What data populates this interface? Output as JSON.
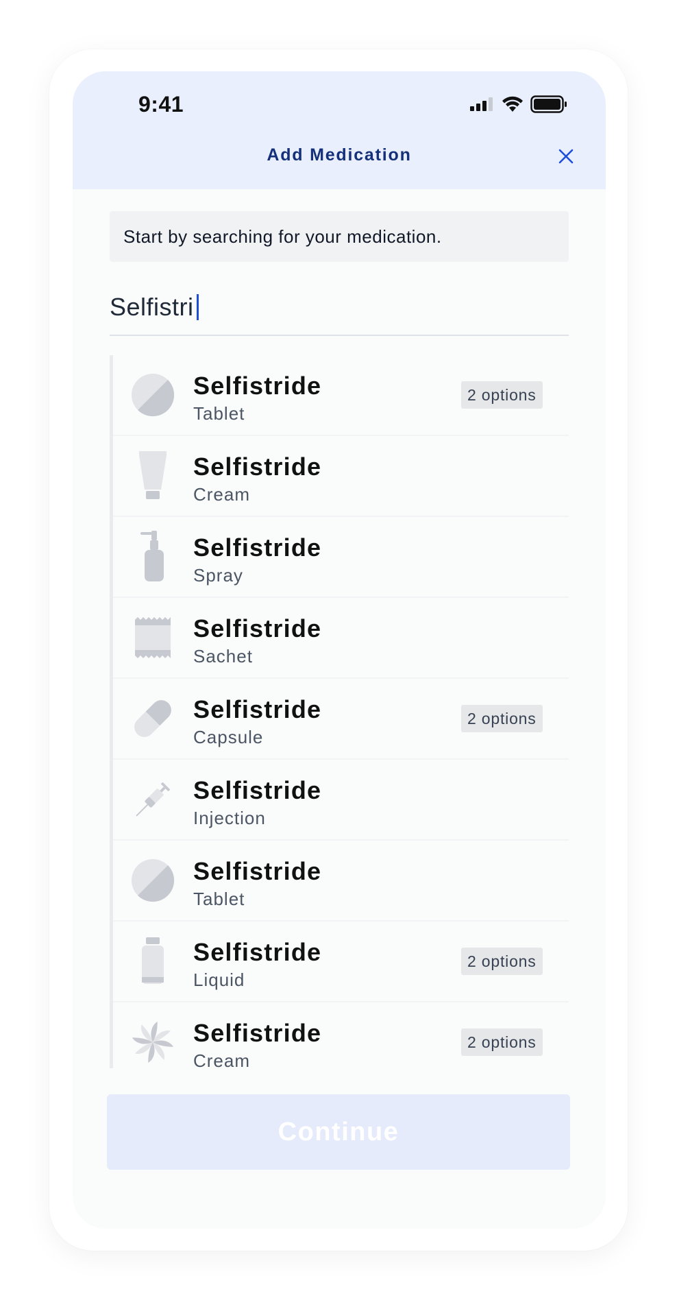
{
  "status_bar": {
    "time": "9:41"
  },
  "header": {
    "title": "Add Medication"
  },
  "hint": "Start by searching for your medication.",
  "search": {
    "value": "Selfistri"
  },
  "results": [
    {
      "name": "Selfistride",
      "form": "Tablet",
      "icon": "tablet-icon",
      "badge": "2 options"
    },
    {
      "name": "Selfistride",
      "form": "Cream",
      "icon": "cream-tube-icon",
      "badge": ""
    },
    {
      "name": "Selfistride",
      "form": "Spray",
      "icon": "spray-bottle-icon",
      "badge": ""
    },
    {
      "name": "Selfistride",
      "form": "Sachet",
      "icon": "sachet-icon",
      "badge": ""
    },
    {
      "name": "Selfistride",
      "form": "Capsule",
      "icon": "capsule-icon",
      "badge": "2 options"
    },
    {
      "name": "Selfistride",
      "form": "Injection",
      "icon": "syringe-icon",
      "badge": ""
    },
    {
      "name": "Selfistride",
      "form": "Tablet",
      "icon": "tablet-icon",
      "badge": ""
    },
    {
      "name": "Selfistride",
      "form": "Liquid",
      "icon": "liquid-bottle-icon",
      "badge": "2 options"
    },
    {
      "name": "Selfistride",
      "form": "Cream",
      "icon": "pinwheel-icon",
      "badge": "2 options"
    }
  ],
  "continue_label": "Continue",
  "colors": {
    "header_bg": "#e9effd",
    "title": "#14307a",
    "accent": "#1d4ed8",
    "button_disabled": "#e5ebfb"
  }
}
